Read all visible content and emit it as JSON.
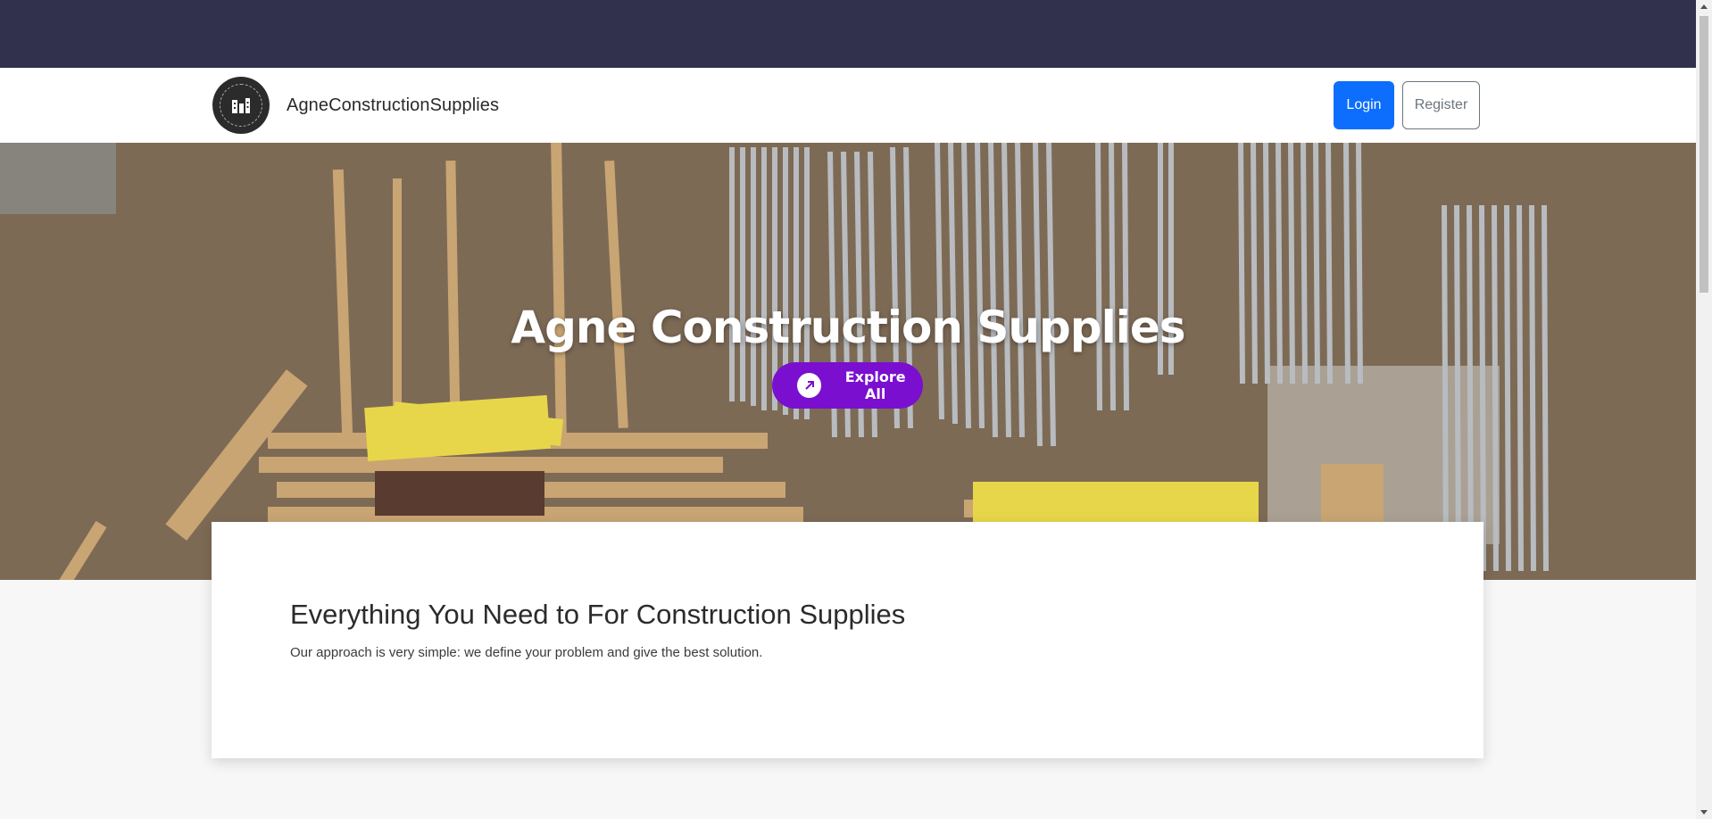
{
  "header": {
    "brand_name": "AgneConstructionSupplies",
    "logo_icon": "building-logo-icon",
    "login_label": "Login",
    "register_label": "Register"
  },
  "hero": {
    "title": "Agne Construction Supplies",
    "cta_label": "Explore All",
    "cta_icon": "arrow-up-right-icon",
    "image": "construction-materials-photo"
  },
  "intro": {
    "heading": "Everything You Need to For Construction Supplies",
    "text": "Our approach is very simple: we define your problem and give the best solution."
  },
  "colors": {
    "topbar": "#31304d",
    "login_button": "#0d6efd",
    "explore_button": "#7a0fd0"
  }
}
